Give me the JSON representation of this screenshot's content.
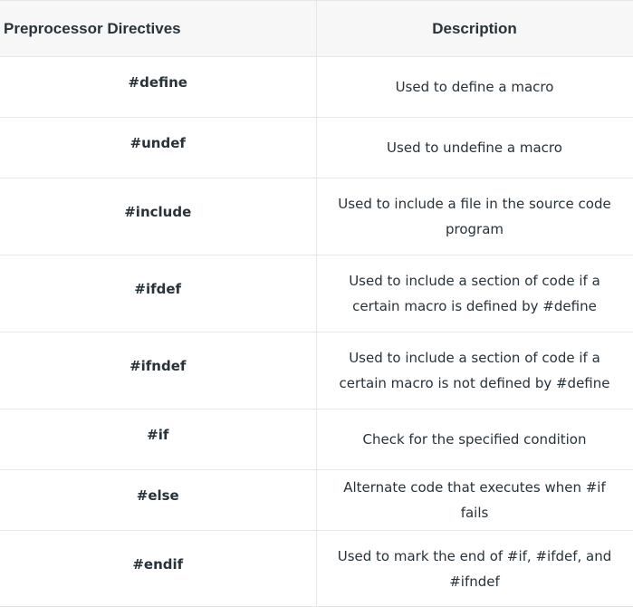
{
  "table": {
    "headers": [
      "Preprocessor Directives",
      "Description"
    ],
    "rows": [
      {
        "directive": "#define",
        "description": "Used to define a macro"
      },
      {
        "directive": "#undef",
        "description": "Used to undefine a macro"
      },
      {
        "directive": "#include",
        "description": "Used to include a file in the source code program"
      },
      {
        "directive": "#ifdef",
        "description": "Used to include a section of code if a certain macro is defined by #define"
      },
      {
        "directive": "#ifndef",
        "description": "Used to include a section of code if a certain macro is not defined by #define"
      },
      {
        "directive": "#if",
        "description": "Check for the specified condition"
      },
      {
        "directive": "#else",
        "description": "Alternate code that executes when #if fails"
      },
      {
        "directive": "#endif",
        "description": "Used to mark the end of #if, #ifdef, and #ifndef"
      }
    ]
  }
}
